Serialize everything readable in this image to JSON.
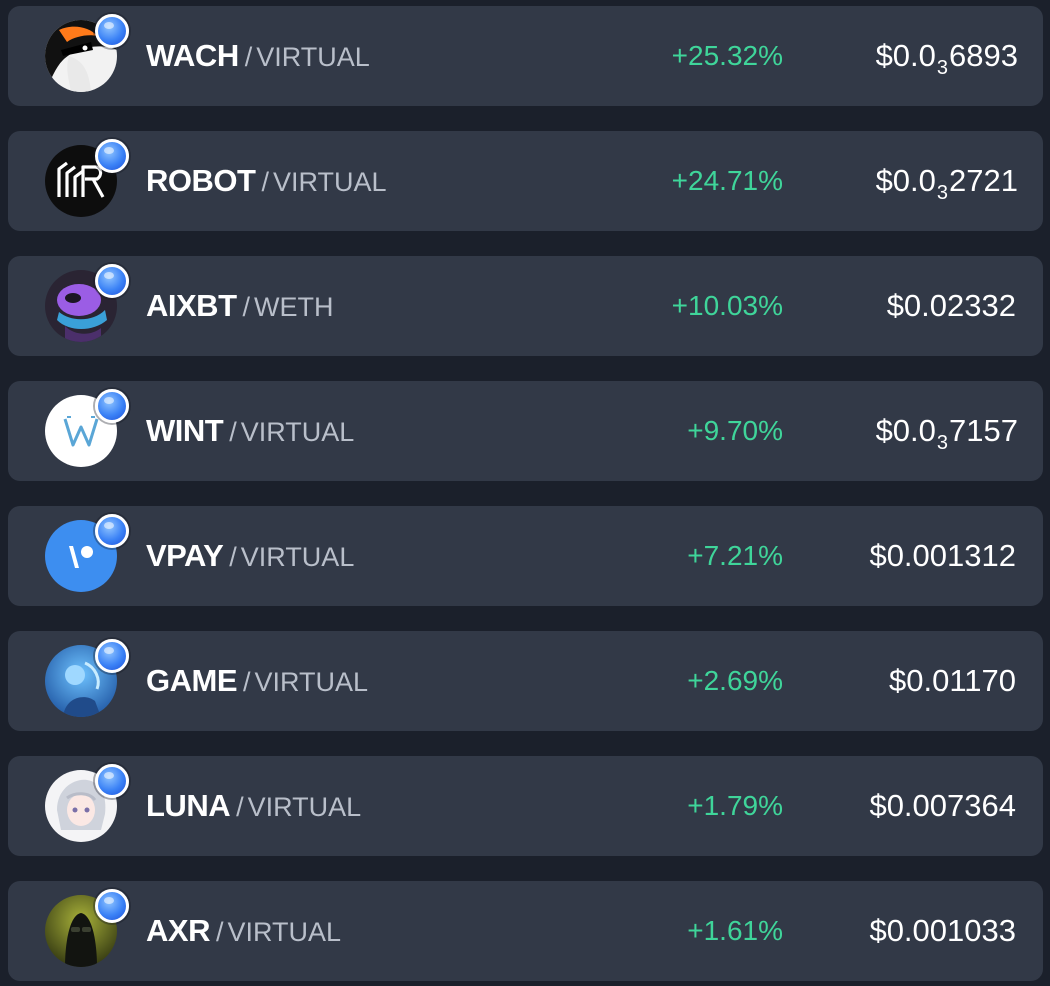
{
  "colors": {
    "background": "#1b202b",
    "row_background": "#323947",
    "positive_change": "#3fd59a",
    "symbol_text": "#ffffff",
    "quote_text": "#b9bfca",
    "chain_badge": "#3b82f6"
  },
  "pairs": [
    {
      "symbol": "WACH",
      "separator": "/",
      "quote": "VIRTUAL",
      "change": "+25.32%",
      "price": {
        "prefix": "$0.0",
        "zeros": "3",
        "digits": "6893"
      },
      "avatar_icon": "masked-figure-icon"
    },
    {
      "symbol": "ROBOT",
      "separator": "/",
      "quote": "VIRTUAL",
      "change": "+24.71%",
      "price": {
        "prefix": "$0.0",
        "zeros": "3",
        "digits": "2721"
      },
      "avatar_icon": "robot-logo-icon"
    },
    {
      "symbol": "AIXBT",
      "separator": "/",
      "quote": "WETH",
      "change": "+10.03%",
      "price": {
        "prefix": "$0.02332",
        "zeros": "",
        "digits": ""
      },
      "avatar_icon": "purple-character-icon"
    },
    {
      "symbol": "WINT",
      "separator": "/",
      "quote": "VIRTUAL",
      "change": "+9.70%",
      "price": {
        "prefix": "$0.0",
        "zeros": "3",
        "digits": "7157"
      },
      "avatar_icon": "w-logo-icon"
    },
    {
      "symbol": "VPAY",
      "separator": "/",
      "quote": "VIRTUAL",
      "change": "+7.21%",
      "price": {
        "prefix": "$0.001312",
        "zeros": "",
        "digits": ""
      },
      "avatar_icon": "vpay-logo-icon"
    },
    {
      "symbol": "GAME",
      "separator": "/",
      "quote": "VIRTUAL",
      "change": "+2.69%",
      "price": {
        "prefix": "$0.01170",
        "zeros": "",
        "digits": ""
      },
      "avatar_icon": "game-character-icon"
    },
    {
      "symbol": "LUNA",
      "separator": "/",
      "quote": "VIRTUAL",
      "change": "+1.79%",
      "price": {
        "prefix": "$0.007364",
        "zeros": "",
        "digits": ""
      },
      "avatar_icon": "anime-girl-icon"
    },
    {
      "symbol": "AXR",
      "separator": "/",
      "quote": "VIRTUAL",
      "change": "+1.61%",
      "price": {
        "prefix": "$0.001033",
        "zeros": "",
        "digits": ""
      },
      "avatar_icon": "hooded-figure-icon"
    }
  ]
}
